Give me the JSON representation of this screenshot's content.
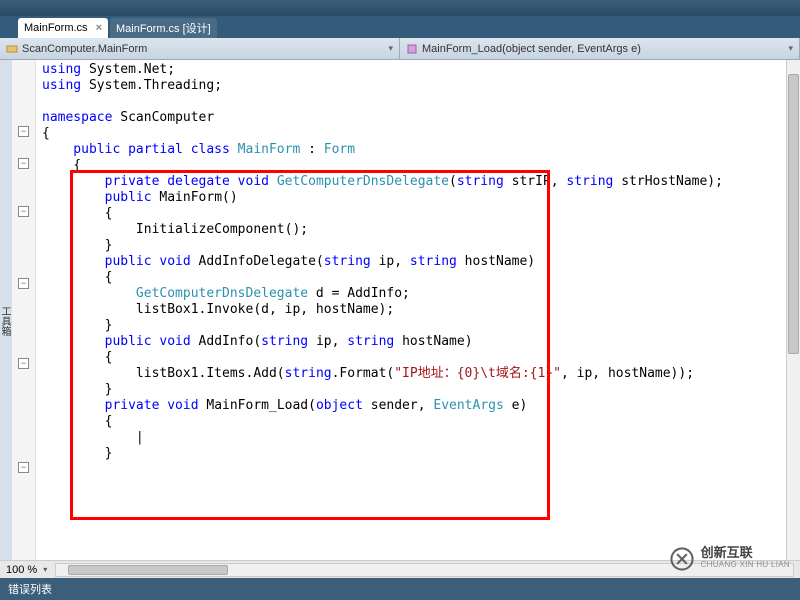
{
  "tabs": {
    "active": "MainForm.cs",
    "inactive": "MainForm.cs [设计]"
  },
  "dropdowns": {
    "left": "ScanComputer.MainForm",
    "right": "MainForm_Load(object sender, EventArgs e)"
  },
  "sidebar_label": "工具箱",
  "zoom": "100 %",
  "status": "错误列表",
  "watermark": {
    "cn": "创新互联",
    "en": "CHUANG XIN HU LIAN"
  },
  "code": {
    "l1a": "using",
    "l1b": " System.Net;",
    "l2a": "using",
    "l2b": " System.Threading;",
    "l3a": "namespace",
    "l3b": " ScanComputer",
    "l4": "{",
    "l5a": "    public partial class ",
    "l5b": "MainForm",
    "l5c": " : ",
    "l5d": "Form",
    "l6": "    {",
    "l7a": "        private delegate void ",
    "l7b": "GetComputerDnsDelegate",
    "l7c": "(",
    "l7d": "string",
    "l7e": " strIP, ",
    "l7f": "string",
    "l7g": " strHostName);",
    "l8a": "        public",
    "l8b": " MainForm()",
    "l9": "        {",
    "l10": "            InitializeComponent();",
    "l11": "        }",
    "l12a": "        public void",
    "l12b": " AddInfoDelegate(",
    "l12c": "string",
    "l12d": " ip, ",
    "l12e": "string",
    "l12f": " hostName)",
    "l13": "        {",
    "l14a": "            GetComputerDnsDelegate",
    "l14b": " d = AddInfo;",
    "l15": "            listBox1.Invoke(d, ip, hostName);",
    "l16": "        }",
    "l17a": "        public void",
    "l17b": " AddInfo(",
    "l17c": "string",
    "l17d": " ip, ",
    "l17e": "string",
    "l17f": " hostName)",
    "l18": "        {",
    "l19a": "            listBox1.Items.Add(",
    "l19b": "string",
    "l19c": ".Format(",
    "l19d": "\"IP地址：{0}\\t域名:{1}\"",
    "l19e": ", ip, hostName));",
    "l20": "        }",
    "l21": "",
    "l22": "",
    "l23a": "        private void",
    "l23b": " MainForm_Load(",
    "l23c": "object",
    "l23d": " sender, ",
    "l23e": "EventArgs",
    "l23f": " e)",
    "l24": "        {",
    "l25": "            |",
    "l26": "        }"
  }
}
